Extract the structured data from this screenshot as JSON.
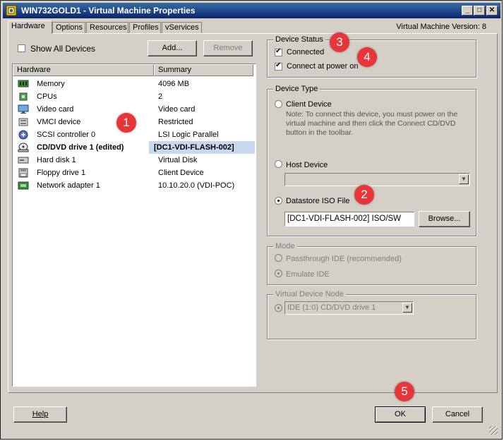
{
  "window": {
    "title": "WIN732GOLD1 - Virtual Machine Properties",
    "minimize": "_",
    "maximize": "□",
    "close": "✕"
  },
  "tabs": [
    {
      "label": "Hardware"
    },
    {
      "label": "Options"
    },
    {
      "label": "Resources"
    },
    {
      "label": "Profiles"
    },
    {
      "label": "vServices"
    }
  ],
  "vm_version": "Virtual Machine Version: 8",
  "hardware": {
    "show_all_devices": "Show All Devices",
    "add_button": "Add...",
    "remove_button": "Remove",
    "col_hardware": "Hardware",
    "col_summary": "Summary",
    "rows": [
      {
        "name": "Memory",
        "summary": "4096 MB",
        "icon": "memory-icon"
      },
      {
        "name": "CPUs",
        "summary": "2",
        "icon": "cpu-icon"
      },
      {
        "name": "Video card",
        "summary": "Video card",
        "icon": "monitor-icon"
      },
      {
        "name": "VMCI device",
        "summary": "Restricted",
        "icon": "vmci-icon"
      },
      {
        "name": "SCSI controller 0",
        "summary": "LSI Logic Parallel",
        "icon": "scsi-icon"
      },
      {
        "name": "CD/DVD drive 1 (edited)",
        "summary": "[DC1-VDI-FLASH-002]",
        "icon": "cd-drive-icon"
      },
      {
        "name": "Hard disk 1",
        "summary": "Virtual Disk",
        "icon": "hard-disk-icon"
      },
      {
        "name": "Floppy drive 1",
        "summary": "Client Device",
        "icon": "floppy-icon"
      },
      {
        "name": "Network adapter 1",
        "summary": "10.10.20.0 (VDI-POC)",
        "icon": "network-icon"
      }
    ]
  },
  "device_status": {
    "legend": "Device Status",
    "connected": "Connected",
    "connect_at_power_on": "Connect at power on"
  },
  "device_type": {
    "legend": "Device Type",
    "client_device": "Client Device",
    "note_line1": "Note: To connect this device, you must power on the",
    "note_line2": "virtual machine and then click the Connect CD/DVD",
    "note_line3": "button in the toolbar.",
    "host_device": "Host Device",
    "datastore_iso": "Datastore ISO File",
    "iso_path": "[DC1-VDI-FLASH-002] ISO/SW",
    "browse_button": "Browse..."
  },
  "mode": {
    "legend": "Mode",
    "passthrough": "Passthrough IDE (recommended)",
    "emulate": "Emulate IDE"
  },
  "vdn": {
    "legend": "Virtual Device Node",
    "value": "IDE (1:0) CD/DVD drive 1"
  },
  "footer": {
    "help_button": "Help",
    "ok_button": "OK",
    "cancel_button": "Cancel"
  },
  "callouts": [
    "1",
    "2",
    "3",
    "4",
    "5"
  ],
  "colors": {
    "callout": "#e8353a",
    "titlebar": "#0a246a",
    "selection": "#c7d8ef"
  }
}
